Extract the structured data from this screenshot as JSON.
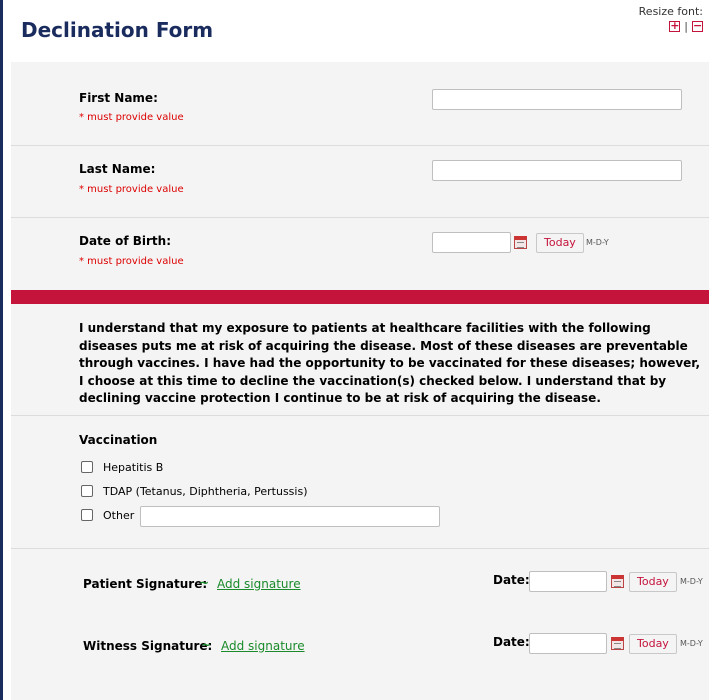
{
  "header": {
    "title": "Declination Form",
    "resize_label": "Resize font:",
    "increase_symbol": "+",
    "separator": "|",
    "decrease_symbol": "−"
  },
  "fields": {
    "first_name": {
      "label": "First Name:",
      "required": "* must provide value",
      "value": ""
    },
    "last_name": {
      "label": "Last Name:",
      "required": "* must provide value",
      "value": ""
    },
    "dob": {
      "label": "Date of Birth:",
      "required": "* must provide value",
      "value": "",
      "today_label": "Today",
      "format": "M-D-Y"
    }
  },
  "statement": "I understand that my exposure to patients at healthcare facilities with the following diseases puts me at risk of acquiring the disease. Most of these diseases are preventable through vaccines. I have had the opportunity to be vaccinated for these diseases; however, I choose at this time to decline the vaccination(s) checked below. I understand that by declining vaccine protection I continue to be at risk of acquiring the disease.",
  "vaccination": {
    "heading": "Vaccination",
    "options": [
      {
        "label": "Hepatitis B",
        "checked": false
      },
      {
        "label": "TDAP (Tetanus, Diphtheria, Pertussis)",
        "checked": false
      },
      {
        "label": "Other",
        "checked": false
      }
    ],
    "other_value": ""
  },
  "signatures": {
    "patient": {
      "label": "Patient Signature:",
      "link": "Add signature",
      "date_label": "Date:",
      "date_value": "",
      "today_label": "Today",
      "format": "M-D-Y"
    },
    "witness": {
      "label": "Witness Signature:",
      "link": "Add signature",
      "date_label": "Date:",
      "date_value": "",
      "today_label": "Today",
      "format": "M-D-Y"
    }
  },
  "colors": {
    "brand_navy": "#1a2b5e",
    "accent_red": "#c4143c",
    "required_red": "#dd0000",
    "link_green": "#1a8a2a"
  }
}
